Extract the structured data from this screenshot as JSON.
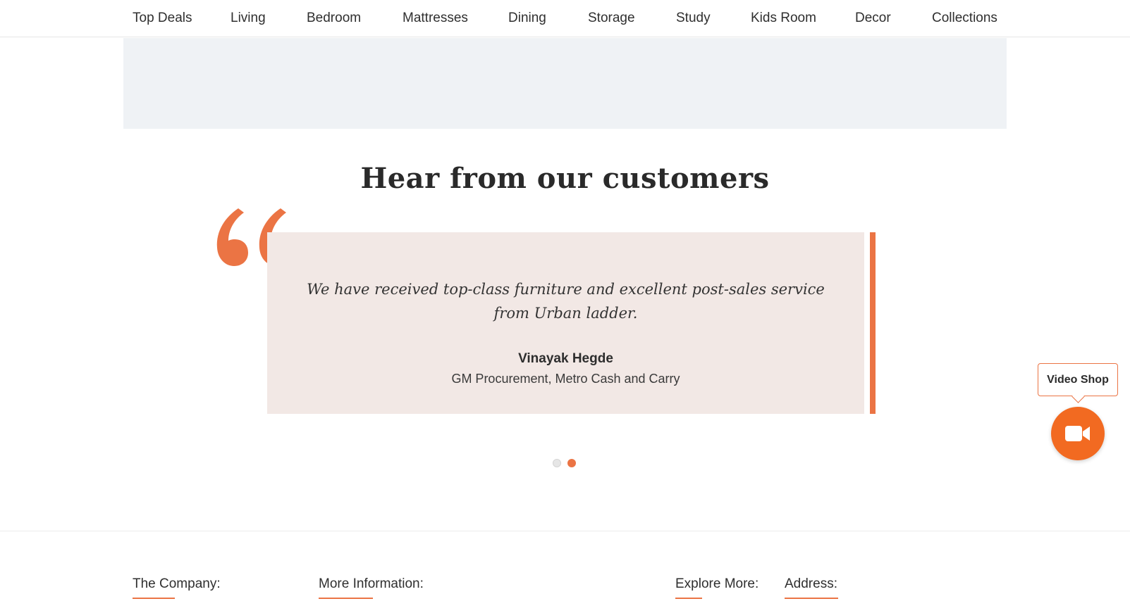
{
  "nav": {
    "items": [
      {
        "label": "Top Deals"
      },
      {
        "label": "Living"
      },
      {
        "label": "Bedroom"
      },
      {
        "label": "Mattresses"
      },
      {
        "label": "Dining"
      },
      {
        "label": "Storage"
      },
      {
        "label": "Study"
      },
      {
        "label": "Kids Room"
      },
      {
        "label": "Decor"
      },
      {
        "label": "Collections"
      }
    ]
  },
  "testimonials": {
    "title": "Hear from our customers",
    "quote_icon": "quote-open-icon",
    "quote_lines": [
      "We have received top-class furniture and excellent post-sales service",
      "from Urban ladder."
    ],
    "author": "Vinayak Hegde",
    "role": "GM Procurement, Metro Cash and Carry",
    "pagination": {
      "count": 2,
      "active_index": 2
    }
  },
  "video_shop": {
    "label": "Video Shop",
    "icon": "video-camera-icon"
  },
  "footer": {
    "headings": [
      {
        "label": "The Company:"
      },
      {
        "label": "More Information:"
      },
      {
        "label": "Explore More:"
      },
      {
        "label": "Address:"
      }
    ]
  },
  "colors": {
    "accent": "#eb7444",
    "video_button": "#f26a21",
    "card_bg": "#f2e8e5",
    "banner_bg": "#eff2f5"
  }
}
